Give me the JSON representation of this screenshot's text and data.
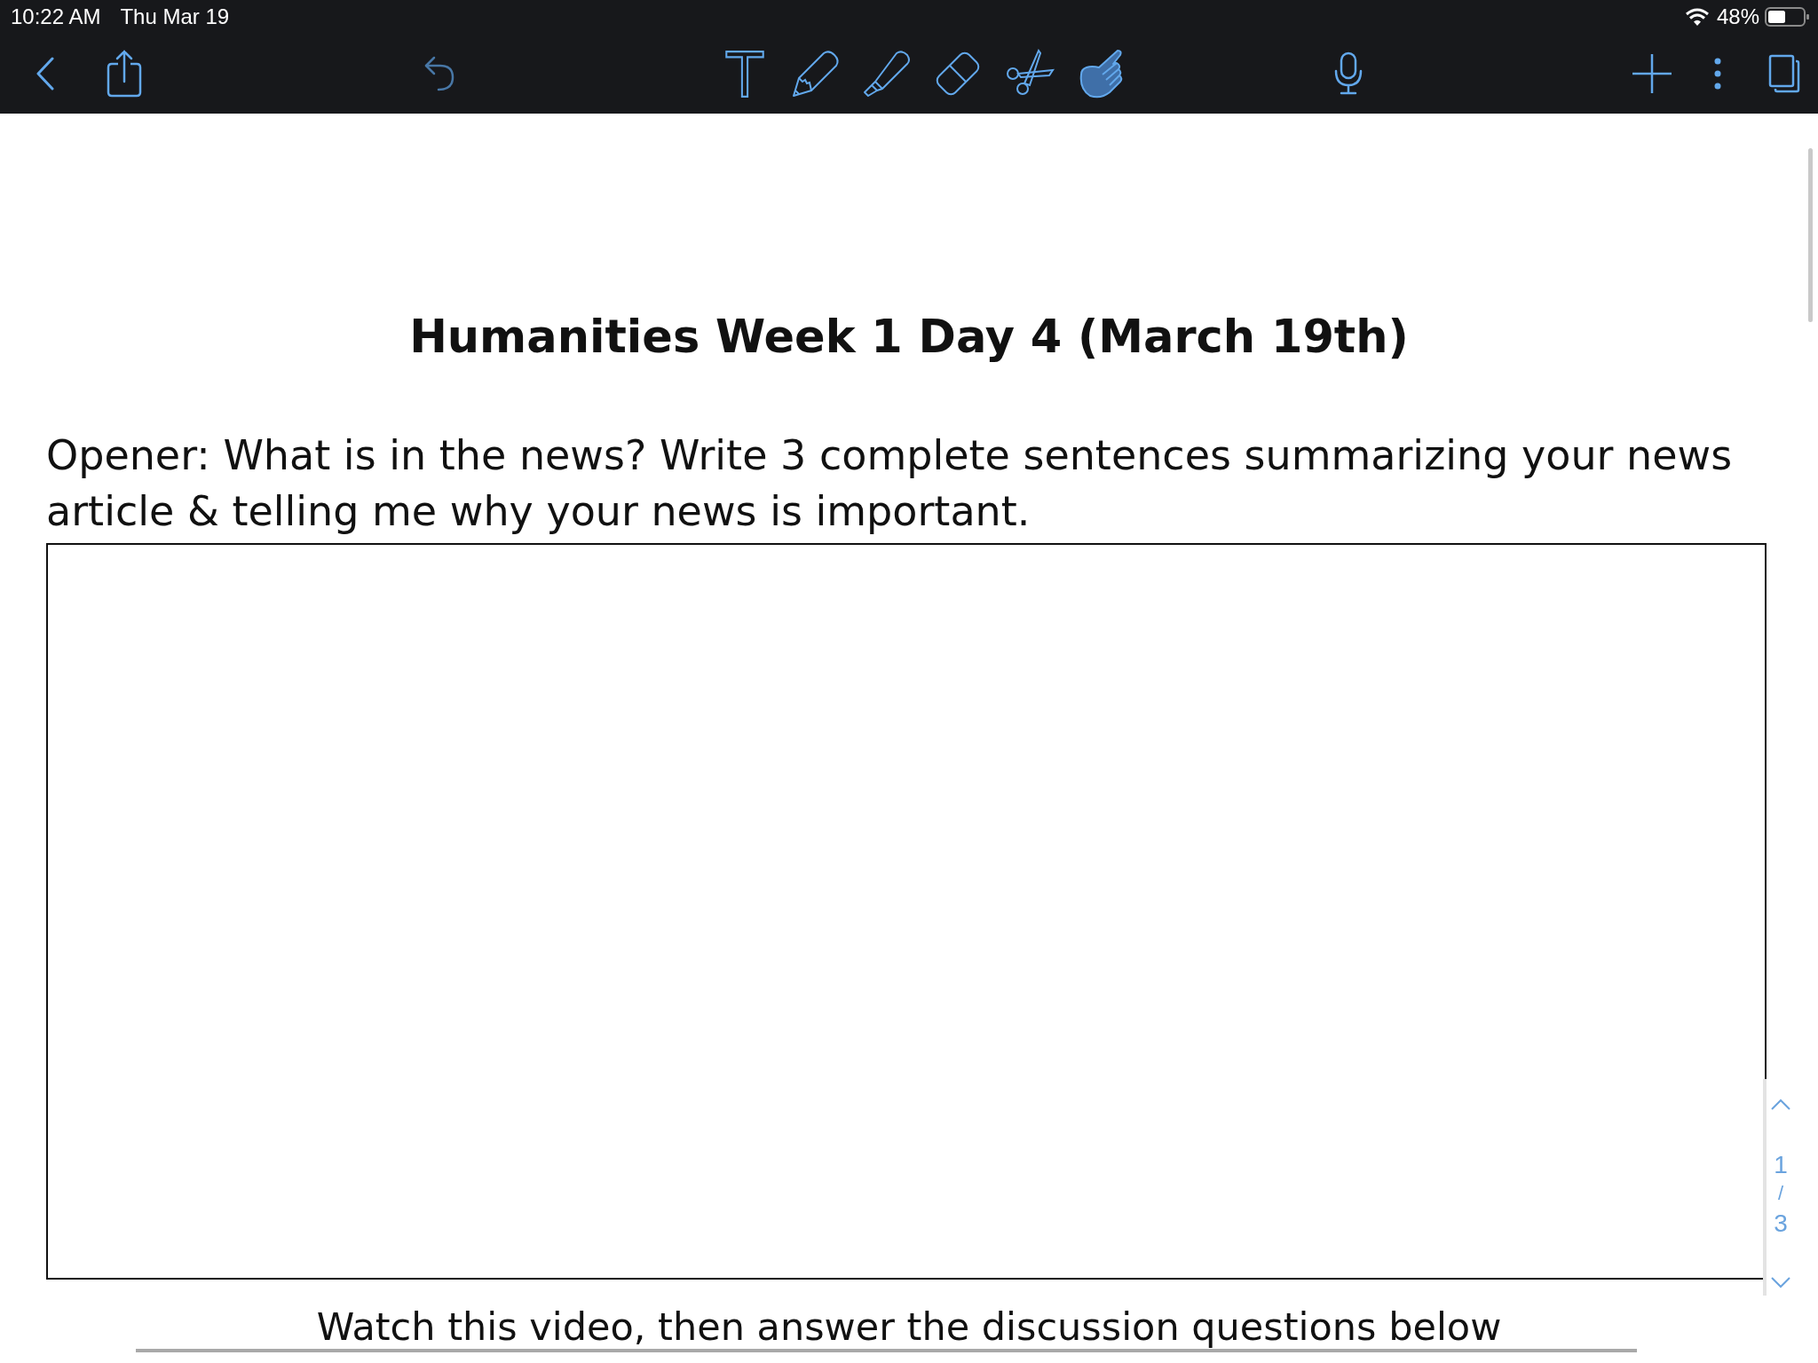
{
  "status_bar": {
    "time": "10:22 AM",
    "date": "Thu Mar 19",
    "battery": "48%"
  },
  "toolbar": {
    "undo": {
      "disabled": true
    },
    "tools": [
      {
        "kind": "text",
        "selected": false
      },
      {
        "kind": "pen",
        "selected": false
      },
      {
        "kind": "highlighter",
        "selected": false
      },
      {
        "kind": "eraser",
        "selected": false
      },
      {
        "kind": "scissors",
        "selected": false
      },
      {
        "kind": "hand",
        "selected": true
      }
    ]
  },
  "document": {
    "title": "Humanities Week 1 Day 4 (March 19th)",
    "prompt": "Opener: What is in the news? Write 3 complete sentences summarizing your news article & telling me why your news is important.",
    "next_instruction": "Watch this video, then answer the discussion questions below"
  },
  "page_indicator": {
    "current": "1",
    "separator": "/",
    "total": "3"
  }
}
